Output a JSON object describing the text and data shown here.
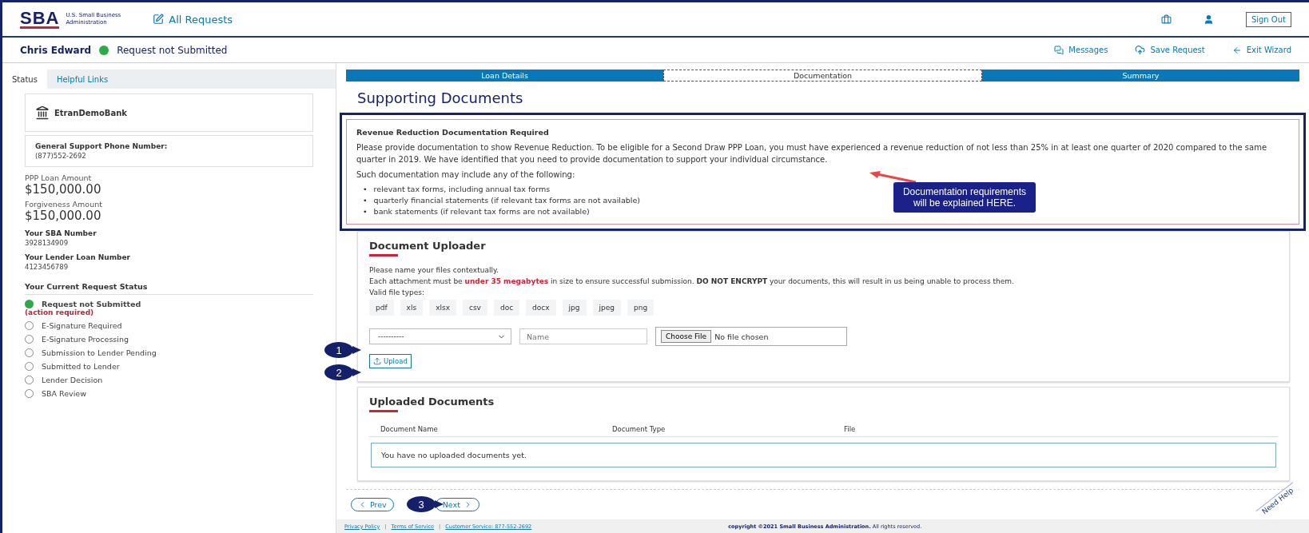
{
  "header": {
    "logo": "SBA",
    "agency": [
      "U.S. Small Business",
      "Administration"
    ],
    "all_requests": "All Requests",
    "sign_out": "Sign Out"
  },
  "subheader": {
    "name": "Chris Edward",
    "status": "Request not Submitted",
    "actions": [
      {
        "kind": "messages",
        "label": "Messages"
      },
      {
        "kind": "save",
        "label": "Save Request"
      },
      {
        "kind": "exit",
        "label": "Exit Wizard"
      }
    ]
  },
  "sidebar": {
    "tabs": [
      {
        "label": "Status",
        "selected": true
      },
      {
        "label": "Helpful Links",
        "selected": false
      }
    ],
    "bank": "EtranDemoBank",
    "phone_label": "General Support Phone Number:",
    "phone": "(877)552-2692",
    "amounts": [
      {
        "label": "PPP Loan Amount",
        "value": "$150,000.00"
      },
      {
        "label": "Forgiveness Amount",
        "value": "$150,000.00"
      }
    ],
    "numbers": [
      {
        "label": "Your SBA Number",
        "value": "3928134909"
      },
      {
        "label": "Your Lender Loan Number",
        "value": "4123456789"
      }
    ],
    "status_heading": "Your Current Request Status",
    "statuses": [
      {
        "label": "Request not Submitted",
        "note": "(action required)",
        "selected": true
      },
      {
        "label": "E-Signature Required",
        "selected": false
      },
      {
        "label": "E-Signature Processing",
        "selected": false
      },
      {
        "label": "Submission to Lender Pending",
        "selected": false
      },
      {
        "label": "Submitted to Lender",
        "selected": false
      },
      {
        "label": "Lender Decision",
        "selected": false
      },
      {
        "label": "SBA Review",
        "selected": false
      }
    ]
  },
  "steps": [
    {
      "label": "Loan Details",
      "selected": false
    },
    {
      "label": "Documentation",
      "selected": true
    },
    {
      "label": "Summary",
      "selected": false
    }
  ],
  "page_title": "Supporting Documents",
  "requirements": {
    "title": "Revenue Reduction Documentation Required",
    "text": "Please provide documentation to show Revenue Reduction. To be eligible for a Second Draw PPP Loan, you must have experienced a revenue reduction of not less than 25% in at least one quarter of 2020 compared to the same quarter in 2019. We have identified that you need to provide documentation to support your individual circumstance.",
    "intro": "Such documentation may include any of the following:",
    "bullets": [
      {
        "marker": "•",
        "text": "relevant tax forms, including annual tax forms"
      },
      {
        "marker": "•",
        "text": "quarterly financial statements (if relevant tax forms are not available)"
      },
      {
        "marker": "•",
        "text": "bank statements (if relevant tax forms are not available)"
      }
    ]
  },
  "annotation": "Documentation requirements will be explained HERE.",
  "uploader": {
    "title": "Document Uploader",
    "hint": "Please name your files contextually.",
    "note": "Each attachment must be **under 35 megabytes** in size to ensure successful submission. **DO NOT ENCRYPT** your documents, this will result in us being unable to process them.",
    "types_label": "Valid file types:",
    "types": [
      "pdf",
      "xls",
      "xlsx",
      "csv",
      "doc",
      "docx",
      "jpg",
      "jpeg",
      "png"
    ],
    "select_value": "----------",
    "name_placeholder": "Name",
    "choose_file": "Choose File",
    "no_file": "No file chosen",
    "upload": "Upload"
  },
  "uploaded": {
    "title": "Uploaded Documents",
    "columns": [
      "Document Name",
      "Document Type",
      "File"
    ],
    "empty": "You have no uploaded documents yet."
  },
  "callouts": [
    "1",
    "2",
    "3"
  ],
  "nav": {
    "prev": "Prev",
    "next": "Next"
  },
  "footer": {
    "items": [
      {
        "kind": "link",
        "text": "Privacy Policy"
      },
      {
        "kind": "separator",
        "text": "|"
      },
      {
        "kind": "link",
        "text": "Terms of Service"
      },
      {
        "kind": "separator",
        "text": "|"
      },
      {
        "kind": "link",
        "text": "Customer Service: 877-552-2692"
      }
    ],
    "copyright": "**copyright ©2021 Small Business Administration.** All rights reserved."
  },
  "need_help": "Need Help"
}
